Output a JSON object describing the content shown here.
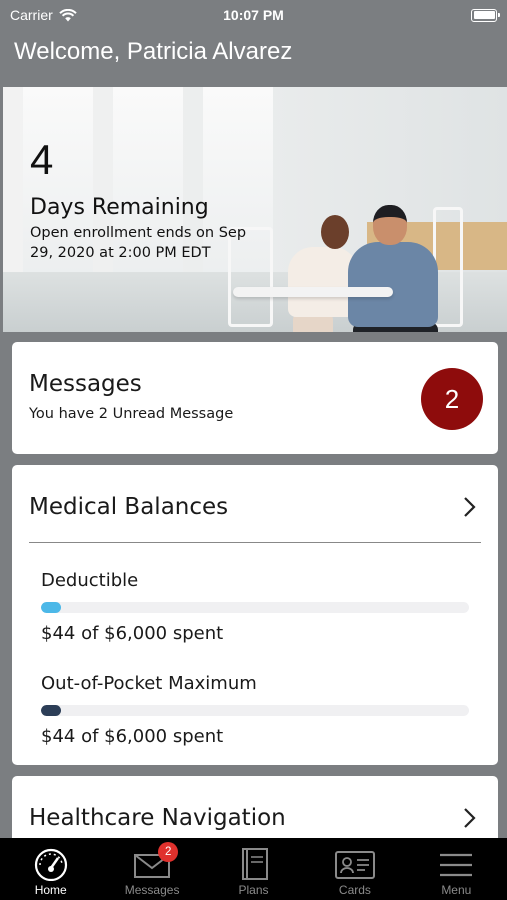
{
  "status_bar": {
    "carrier": "Carrier",
    "time": "10:07 PM"
  },
  "header": {
    "welcome": "Welcome, Patricia Alvarez"
  },
  "enrollment": {
    "days": "4",
    "label": "Days Remaining",
    "subtitle": "Open enrollment ends on Sep 29, 2020 at 2:00 PM EDT"
  },
  "messages": {
    "title": "Messages",
    "subtitle": "You have 2 Unread Message",
    "count": "2",
    "badge_color": "#8e0c0c"
  },
  "medical_balances": {
    "title": "Medical Balances",
    "items": [
      {
        "label": "Deductible",
        "spent": "$44 of $6,000 spent",
        "progress": 0.047,
        "color": "#4cb8e8"
      },
      {
        "label": "Out-of-Pocket Maximum",
        "spent": "$44 of $6,000 spent",
        "progress": 0.047,
        "color": "#2c3e57"
      }
    ]
  },
  "healthcare_navigation": {
    "title": "Healthcare Navigation"
  },
  "tab_bar": {
    "tabs": [
      {
        "label": "Home",
        "icon": "speedometer-icon",
        "active": true
      },
      {
        "label": "Messages",
        "icon": "envelope-icon",
        "badge": "2"
      },
      {
        "label": "Plans",
        "icon": "book-icon"
      },
      {
        "label": "Cards",
        "icon": "id-card-icon"
      },
      {
        "label": "Menu",
        "icon": "hamburger-icon"
      }
    ]
  }
}
